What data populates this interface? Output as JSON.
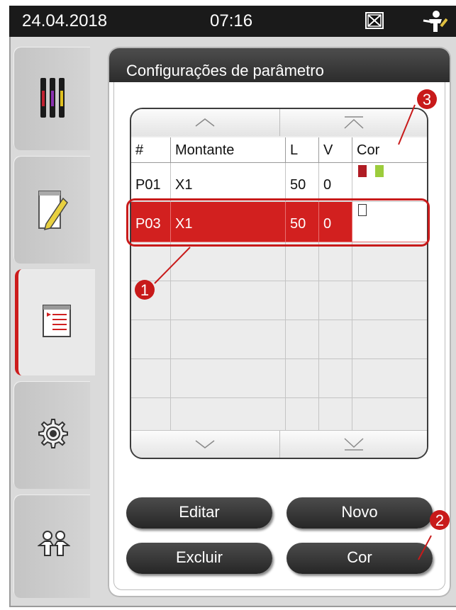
{
  "status_bar": {
    "date": "24.04.2018",
    "time": "07:16",
    "alarm_icon": "alarm-muted-icon",
    "user_icon": "user-supervisor-icon"
  },
  "nav": {
    "items": [
      {
        "id": "reagents",
        "icon": "reagent-bottles-icon",
        "active": false
      },
      {
        "id": "edit",
        "icon": "edit-document-icon",
        "active": false
      },
      {
        "id": "parameters",
        "icon": "parameter-list-icon",
        "active": true
      },
      {
        "id": "settings",
        "icon": "gear-icon",
        "active": false
      },
      {
        "id": "users",
        "icon": "users-icon",
        "active": false
      }
    ]
  },
  "panel": {
    "title": "Configurações de parâmetro"
  },
  "table": {
    "columns": [
      "#",
      "Montante",
      "L",
      "V",
      "Cor"
    ],
    "rows": [
      {
        "id": "P01",
        "montante": "X1",
        "l": "50",
        "v": "0",
        "colors": [
          "#b01c24",
          "#9ccc3c"
        ],
        "selected": false
      },
      {
        "id": "P03",
        "montante": "X1",
        "l": "50",
        "v": "0",
        "colors": [
          "#ffffff"
        ],
        "selected": true
      }
    ]
  },
  "buttons": {
    "edit": "Editar",
    "new": "Novo",
    "delete": "Excluir",
    "color": "Cor"
  },
  "callouts": [
    "1",
    "2",
    "3"
  ],
  "colors": {
    "accent": "#cc1c1c",
    "header": "#3a3a3a"
  }
}
